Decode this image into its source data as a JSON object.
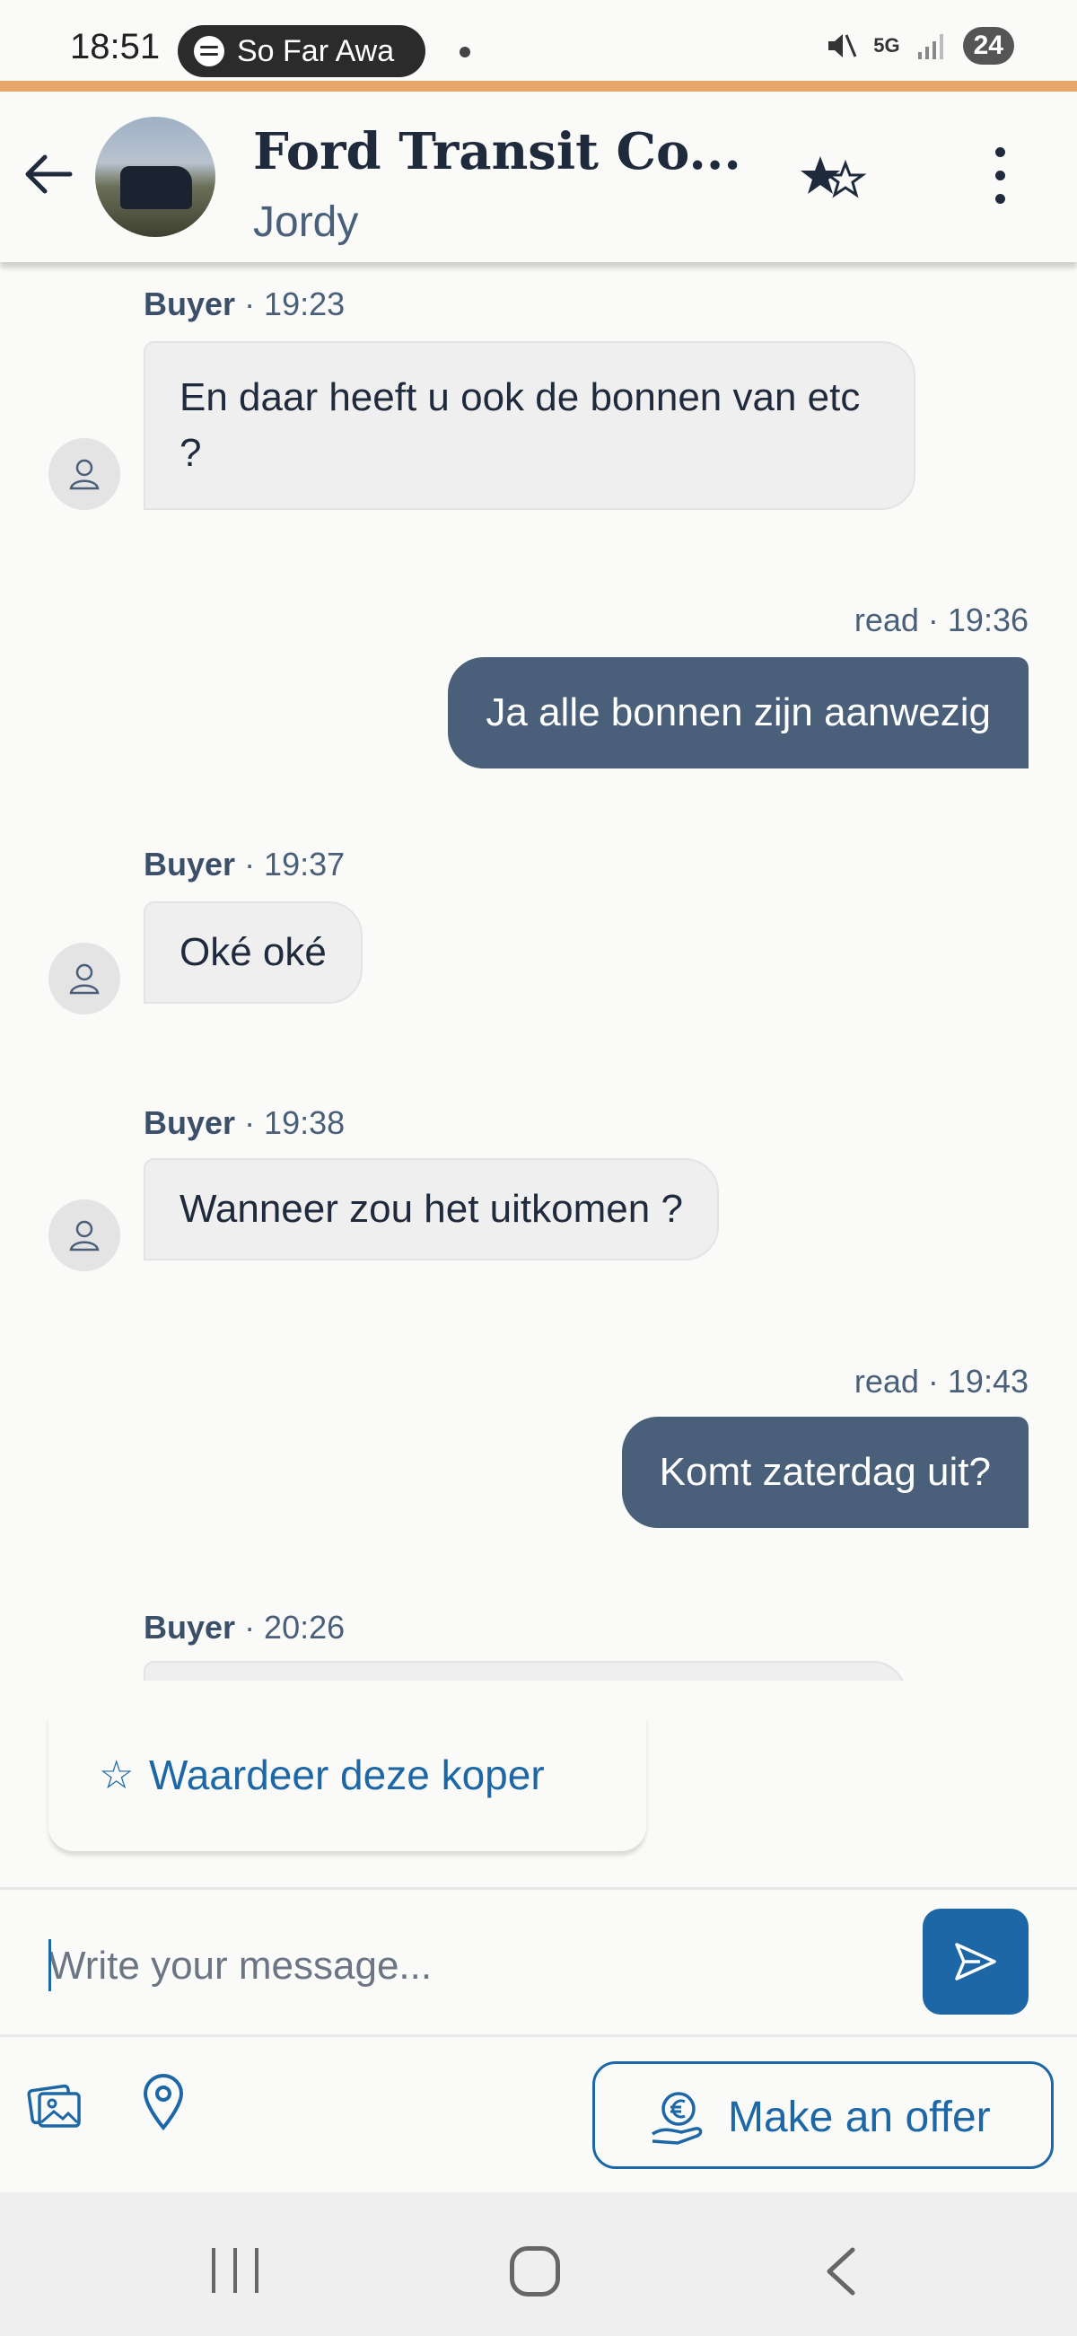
{
  "status_bar": {
    "time": "18:51",
    "media_label": "So Far Awa",
    "network": "5G",
    "battery": "24"
  },
  "header": {
    "title": "Ford Transit Co...",
    "subtitle": "Jordy"
  },
  "messages": [
    {
      "direction": "in",
      "sender": "Buyer",
      "time": "· 19:23",
      "text": "En daar heeft u ook de bonnen van etc ?"
    },
    {
      "direction": "out",
      "status": "read",
      "time": "· 19:36",
      "text": "Ja alle bonnen zijn aanwezig"
    },
    {
      "direction": "in",
      "sender": "Buyer",
      "time": "· 19:37",
      "text": "Oké oké"
    },
    {
      "direction": "in",
      "sender": "Buyer",
      "time": "· 19:38",
      "text": "Wanneer zou het uitkomen ?"
    },
    {
      "direction": "out",
      "status": "read",
      "time": "· 19:43",
      "text": "Komt zaterdag uit?"
    },
    {
      "direction": "in",
      "sender": "Buyer",
      "time": "· 20:26",
      "text": ""
    }
  ],
  "rate_buyer": {
    "star": "☆",
    "label": "Waardeer deze koper"
  },
  "composer": {
    "placeholder": "Write your message..."
  },
  "actions": {
    "offer_label": "Make an offer"
  },
  "colors": {
    "accent": "#1d67a6",
    "bubble_out": "#4a5f7a",
    "bubble_in": "#efefef",
    "status_line": "#e8a66a"
  }
}
